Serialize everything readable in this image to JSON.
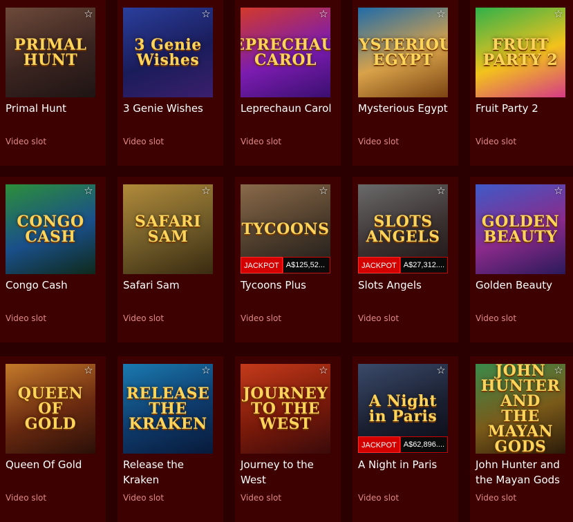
{
  "games": [
    {
      "title": "Primal Hunt",
      "category": "Video slot",
      "art_text": "PRIMAL HUNT",
      "art_bg": "linear-gradient(160deg,#6d4a3a,#3a2420 55%,#1e1414)",
      "jackpot": null
    },
    {
      "title": "3 Genie Wishes",
      "category": "Video slot",
      "art_text": "3 Genie Wishes",
      "art_bg": "linear-gradient(160deg,#2a3f9c,#1a1c5a 55%,#3b1f6d)",
      "jackpot": null
    },
    {
      "title": "Leprechaun Carol",
      "category": "Video slot",
      "art_text": "LEPRECHAUN CAROL",
      "art_bg": "linear-gradient(160deg,#d33a2a,#7b1cb0 55%,#3a0f6f)",
      "jackpot": null
    },
    {
      "title": "Mysterious Egypt",
      "category": "Video slot",
      "art_text": "MYSTERIOUS EGYPT",
      "art_bg": "linear-gradient(160deg,#1f6ba8,#d8a24a 55%,#7a4312)",
      "jackpot": null
    },
    {
      "title": "Fruit Party 2",
      "category": "Video slot",
      "art_text": "FRUIT PARTY 2",
      "art_bg": "linear-gradient(160deg,#2fb14a,#f3c21c 55%,#d53a86)",
      "jackpot": null
    },
    {
      "title": "Congo Cash",
      "category": "Video slot",
      "art_text": "CONGO CASH",
      "art_bg": "linear-gradient(160deg,#2c8f3a,#1a4f8a 55%,#0e2a1a)",
      "jackpot": null
    },
    {
      "title": "Safari Sam",
      "category": "Video slot",
      "art_text": "SAFARI SAM",
      "art_bg": "linear-gradient(160deg,#b08a3a,#6e5a28 55%,#3a2a10)",
      "jackpot": null
    },
    {
      "title": "Tycoons Plus",
      "category": "Video slot",
      "art_text": "TYCOONS",
      "art_bg": "linear-gradient(160deg,#8a6a4a,#4a3a2a 55%,#1a1a1a)",
      "jackpot": {
        "label": "JACKPOT",
        "value": "A$125,52..."
      }
    },
    {
      "title": "Slots Angels",
      "category": "Video slot",
      "art_text": "SLOTS ANGELS",
      "art_bg": "linear-gradient(160deg,#6a6a6a,#3a3030 55%,#1a1414)",
      "jackpot": {
        "label": "JACKPOT",
        "value": "A$27,312...."
      }
    },
    {
      "title": "Golden Beauty",
      "category": "Video slot",
      "art_text": "GOLDEN BEAUTY",
      "art_bg": "linear-gradient(160deg,#3f5ac8,#8a2a8a 55%,#2a1a5a)",
      "jackpot": null
    },
    {
      "title": "Queen Of Gold",
      "category": "Video slot",
      "art_text": "QUEEN OF GOLD",
      "art_bg": "linear-gradient(160deg,#c47a2a,#6a2a10 55%,#2a0f08)",
      "jackpot": null
    },
    {
      "title": "Release the Kraken",
      "category": "Video slot",
      "art_text": "RELEASE THE KRAKEN",
      "art_bg": "linear-gradient(160deg,#1a7ab0,#0e3a6a 55%,#081a3a)",
      "jackpot": null
    },
    {
      "title": "Journey to the West",
      "category": "Video slot",
      "art_text": "JOURNEY TO THE WEST",
      "art_bg": "linear-gradient(160deg,#c43a1a,#7a1a0a 55%,#3a0a0a)",
      "jackpot": null
    },
    {
      "title": "A Night in Paris",
      "category": "Video slot",
      "art_text": "A Night in Paris",
      "art_bg": "linear-gradient(160deg,#3a4a6a,#1a1f30 55%,#0a0a14)",
      "jackpot": {
        "label": "JACKPOT",
        "value": "A$62,896...."
      }
    },
    {
      "title": "John Hunter and the Mayan Gods",
      "category": "Video slot",
      "art_text": "JOHN HUNTER AND THE MAYAN GODS",
      "art_bg": "linear-gradient(160deg,#3a8a4a,#7a5a1a 55%,#2a1a08)",
      "jackpot": null
    }
  ],
  "icons": {
    "favorite": "star-outline-icon"
  },
  "colors": {
    "page_bg": "#2a0000",
    "card_bg": "#3d0101",
    "category_text": "#e08a88",
    "jackpot_red": "#d40000"
  }
}
